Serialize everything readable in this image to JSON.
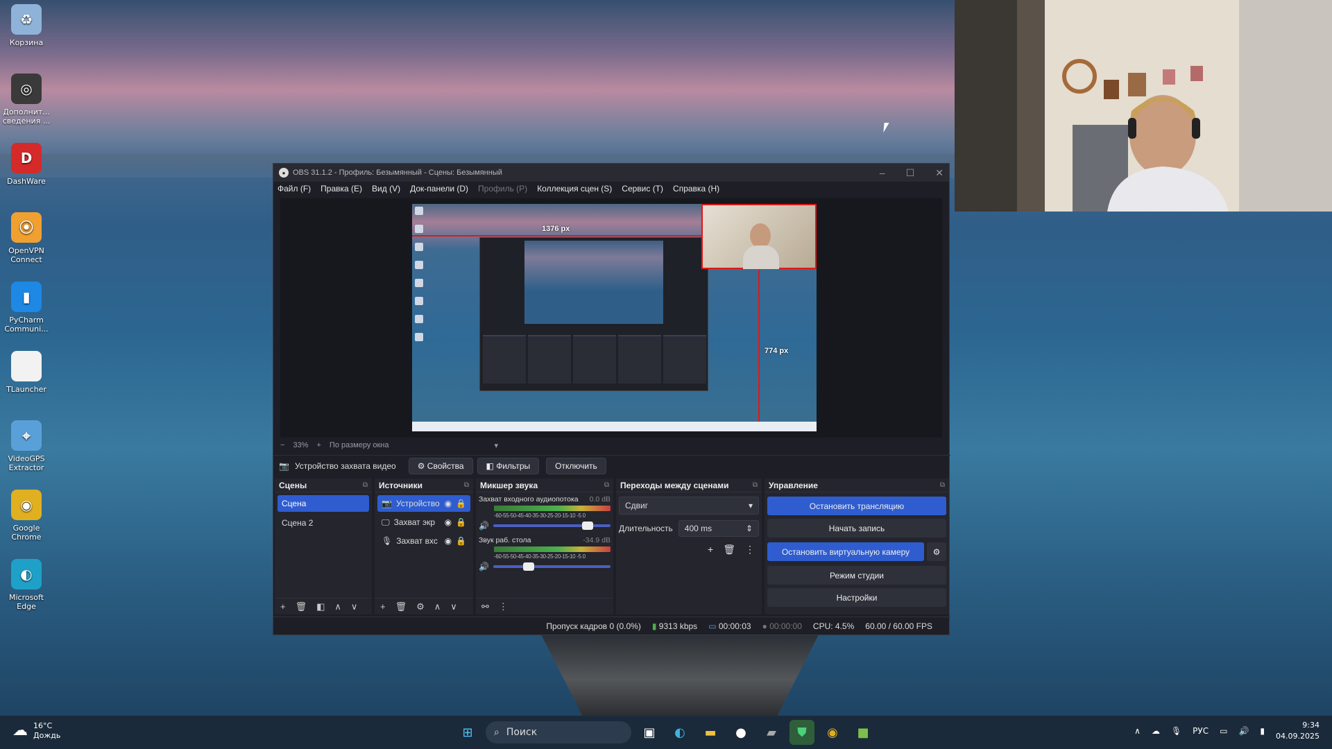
{
  "desktop": {
    "icons": [
      {
        "label": "Корзина",
        "icon": "recycle-bin-icon",
        "color": "#8fb3d8",
        "glyph": "♻"
      },
      {
        "label": "Дополнит... сведения ...",
        "icon": "info-icon",
        "color": "#3a3a3a",
        "glyph": "◎"
      },
      {
        "label": "DashWare",
        "icon": "dashware-icon",
        "color": "#d42a2a",
        "glyph": "D"
      },
      {
        "label": "OpenVPN Connect",
        "icon": "openvpn-icon",
        "color": "#f0a030",
        "glyph": "⦿"
      },
      {
        "label": "PyCharm Communi...",
        "icon": "pycharm-icon",
        "color": "#1e88e5",
        "glyph": "▮"
      },
      {
        "label": "TLauncher",
        "icon": "file-icon",
        "color": "#f2f2f2",
        "glyph": ""
      },
      {
        "label": "VideoGPS Extractor",
        "icon": "videogps-icon",
        "color": "#5aa0d8",
        "glyph": "⌖"
      },
      {
        "label": "Google Chrome",
        "icon": "chrome-icon",
        "color": "#e0b020",
        "glyph": "◉"
      },
      {
        "label": "Microsoft Edge",
        "icon": "edge-icon",
        "color": "#1fa0c8",
        "glyph": "◐"
      }
    ]
  },
  "obs": {
    "title": "OBS 31.1.2 - Профиль: Безымянный - Сцены: Безымянный",
    "menu": [
      "Файл (F)",
      "Правка (E)",
      "Вид (V)",
      "Док-панели (D)",
      "Профиль (P)",
      "Коллекция сцен (S)",
      "Сервис (T)",
      "Справка (H)"
    ],
    "preview": {
      "width_label": "1376 px",
      "height_label": "774 px"
    },
    "zoom": {
      "minus": "−",
      "value": "33%",
      "plus": "+",
      "mode": "По размеру окна"
    },
    "source_bar": {
      "name": "Устройство захвата видео",
      "properties": "Свойства",
      "filters": "Фильтры",
      "disable": "Отключить"
    },
    "scenes": {
      "title": "Сцены",
      "items": [
        "Сцена",
        "Сцена 2"
      ]
    },
    "sources": {
      "title": "Источники",
      "items": [
        {
          "label": "Устройство",
          "icon": "camera-icon"
        },
        {
          "label": "Захват экр",
          "icon": "monitor-icon"
        },
        {
          "label": "Захват вхс",
          "icon": "microphone-icon"
        }
      ]
    },
    "mixer": {
      "title": "Микшер звука",
      "scale": "-60-55-50-45-40-35-30-25-20-15-10 -5 0",
      "channels": [
        {
          "name": "Захват входного аудиопотока",
          "db": "0.0 dB",
          "level": 0.85
        },
        {
          "name": "Звук раб. стола",
          "db": "-34.9 dB",
          "level": 0.35
        }
      ]
    },
    "transitions": {
      "title": "Переходы между сценами",
      "selected": "Сдвиг",
      "duration_label": "Длительность",
      "duration": "400 ms"
    },
    "controls": {
      "title": "Управление",
      "stop_stream": "Остановить трансляцию",
      "start_record": "Начать запись",
      "stop_vcam": "Остановить виртуальную камеру",
      "studio_mode": "Режим студии",
      "settings": "Настройки"
    },
    "status": {
      "dropped": "Пропуск кадров 0 (0.0%)",
      "bitrate": "9313 kbps",
      "stream_time": "00:00:03",
      "rec_time": "00:00:00",
      "cpu": "CPU: 4.5%",
      "fps": "60.00 / 60.00 FPS"
    }
  },
  "taskbar": {
    "temp": "16°C",
    "weather": "Дождь",
    "search": "Поиск",
    "lang": "РУС",
    "time": "9:34",
    "date": "04.09.2025"
  }
}
